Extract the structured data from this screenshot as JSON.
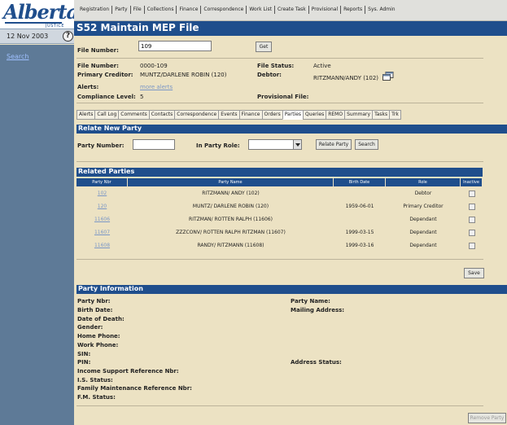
{
  "sidebar": {
    "logo_text": "Alberta",
    "logo_sub": "JUSTICE",
    "date": "12 Nov 2003",
    "help_glyph": "?",
    "search_link": "Search"
  },
  "menu": [
    "Registration",
    "Party",
    "File",
    "Collections",
    "Finance",
    "Correspondence",
    "Work List",
    "Create Task",
    "Provisional",
    "Reports",
    "Sys. Admin"
  ],
  "title": "S52 Maintain MEP File",
  "file_lookup": {
    "label": "File Number:",
    "value": "109",
    "get_label": "Get"
  },
  "file_info": {
    "file_number_label": "File Number:",
    "file_number": "0000-109",
    "primary_creditor_label": "Primary Creditor:",
    "primary_creditor": "MUNTZ/DARLENE ROBIN (120)",
    "alerts_label": "Alerts:",
    "more_alerts": "more alerts",
    "compliance_label": "Compliance Level:",
    "compliance": "5",
    "file_status_label": "File Status:",
    "file_status": "Active",
    "debtor_label": "Debtor:",
    "debtor": "RITZMANN/ANDY (102)",
    "provisional_label": "Provisional File:"
  },
  "tabs": [
    {
      "label": "Alerts",
      "active": false
    },
    {
      "label": "Call Log",
      "active": false
    },
    {
      "label": "Comments",
      "active": false
    },
    {
      "label": "Contacts",
      "active": false
    },
    {
      "label": "Correspondence",
      "active": false
    },
    {
      "label": "Events",
      "active": false
    },
    {
      "label": "Finance",
      "active": false
    },
    {
      "label": "Orders",
      "active": false
    },
    {
      "label": "Parties",
      "active": true
    },
    {
      "label": "Queries",
      "active": false
    },
    {
      "label": "REMO",
      "active": false
    },
    {
      "label": "Summary",
      "active": false
    },
    {
      "label": "Tasks",
      "active": false
    },
    {
      "label": "Trk",
      "active": false
    }
  ],
  "relate": {
    "title": "Relate New Party",
    "party_number_label": "Party Number:",
    "party_number_value": "",
    "role_label": "In Party Role:",
    "role_value": "",
    "relate_button": "Relate Party",
    "search_button": "Search"
  },
  "related": {
    "title": "Related Parties",
    "columns": [
      "Party Nbr",
      "Party Name",
      "Birth Date",
      "Role",
      "Inactive"
    ],
    "rows": [
      {
        "nbr": "102",
        "name": "RITZMANN/ ANDY (102)",
        "birth": "",
        "role": "Debtor",
        "inactive": false
      },
      {
        "nbr": "120",
        "name": "MUNTZ/ DARLENE ROBIN (120)",
        "birth": "1959-06-01",
        "role": "Primary Creditor",
        "inactive": false
      },
      {
        "nbr": "11606",
        "name": "RITZMAN/ ROTTEN RALPH (11606)",
        "birth": "",
        "role": "Dependant",
        "inactive": false
      },
      {
        "nbr": "11607",
        "name": "ZZZCONV/ ROTTEN RALPH RITZMAN (11607)",
        "birth": "1999-03-15",
        "role": "Dependant",
        "inactive": false
      },
      {
        "nbr": "11608",
        "name": "RANDY/ RITZMANN (11608)",
        "birth": "1999-03-16",
        "role": "Dependant",
        "inactive": false
      }
    ],
    "save_button": "Save"
  },
  "party_info": {
    "title": "Party Information",
    "left_labels": [
      "Party Nbr:",
      "Birth Date:",
      "Date of Death:",
      "Gender:",
      "Home Phone:",
      "Work Phone:",
      "SIN:",
      "PIN:",
      "Income Support Reference Nbr:",
      "I.S. Status:",
      "Family Maintenance Reference Nbr:",
      "F.M. Status:"
    ],
    "party_name_label": "Party Name:",
    "mailing_label": "Mailing Address:",
    "address_status_label": "Address Status:",
    "remove_button": "Remove Party"
  },
  "colors": {
    "brand_blue": "#1f4e8c",
    "sidebar_bg": "#5e7a97",
    "content_bg": "#ece2c3",
    "link": "#7b97c6"
  }
}
